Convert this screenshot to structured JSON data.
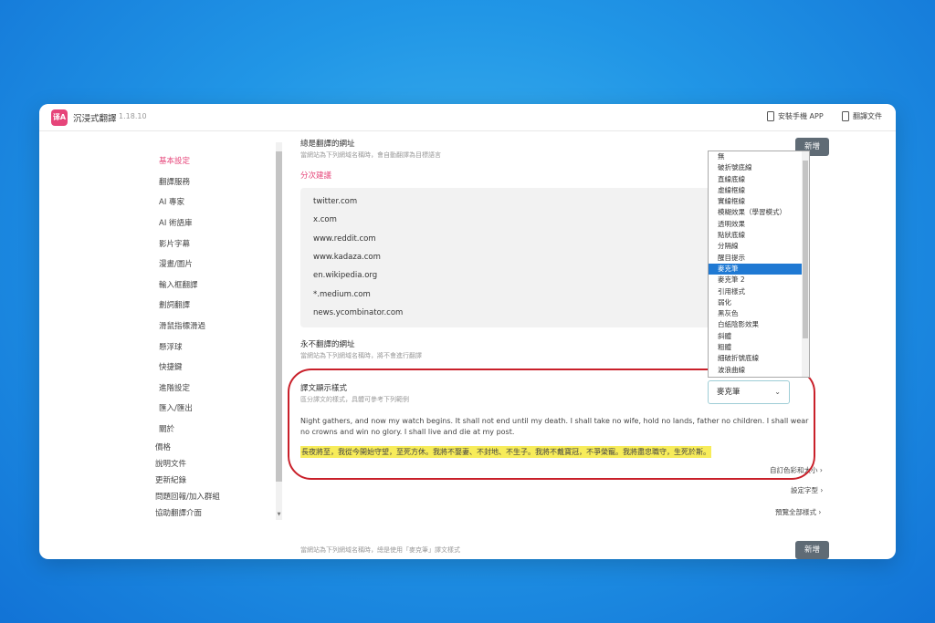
{
  "app": {
    "name": "沉浸式翻譯",
    "version": "1.18.10",
    "logo_text": "译A"
  },
  "topbar": {
    "install_app": "安裝手機 APP",
    "docs": "翻譯文件"
  },
  "sidebar": {
    "items": [
      {
        "label": "基本設定"
      },
      {
        "label": "翻譯服務"
      },
      {
        "label": "AI 專家"
      },
      {
        "label": "AI 術語庫"
      },
      {
        "label": "影片字幕"
      },
      {
        "label": "漫畫/圖片"
      },
      {
        "label": "輸入框翻譯"
      },
      {
        "label": "劃詞翻譯"
      },
      {
        "label": "滑鼠指標滑過"
      },
      {
        "label": "懸浮球"
      },
      {
        "label": "快捷鍵"
      },
      {
        "label": "進階設定"
      },
      {
        "label": "匯入/匯出"
      },
      {
        "label": "關於"
      }
    ],
    "links": [
      {
        "label": "價格"
      },
      {
        "label": "說明文件"
      },
      {
        "label": "更新紀錄"
      },
      {
        "label": "問題回報/加入群組"
      },
      {
        "label": "協助翻譯介面"
      }
    ]
  },
  "main": {
    "always_title": "總是翻譯的網址",
    "always_hint": "當網站為下列網域名稱時，會自動翻譯為目標語言",
    "add_label": "新增",
    "suggestion_title": "分次建議",
    "urls": [
      "twitter.com",
      "x.com",
      "www.reddit.com",
      "www.kadaza.com",
      "en.wikipedia.org",
      "*.medium.com",
      "news.ycombinator.com"
    ],
    "never_title": "永不翻譯的網址",
    "never_hint": "當網站為下列網域名稱時，將不會進行翻譯",
    "style_title": "譯文顯示樣式",
    "style_hint": "區分譯文的樣式，具體可參考下列範例",
    "selected_style": "麥克筆",
    "sample_en": "Night gathers, and now my watch begins. It shall not end until my death. I shall take no wife, hold no lands, father no children. I shall wear no crowns and win no glory. I shall live and die at my post.",
    "sample_zh": "長夜將至，我從今開始守望，至死方休。我將不娶妻、不封地、不生子。我將不戴寶冠，不爭榮寵。我將盡忠職守，生死於斯。",
    "custom_color": "自訂色彩和大小",
    "set_font": "設定字型",
    "preview_all": "預覽全部樣式",
    "footer_hint": "當網站為下列網域名稱時，總是使用「麥克筆」譯文樣式",
    "footer_add": "新增"
  },
  "dropdown": {
    "options": [
      "無",
      "破折號底線",
      "直線底線",
      "虛線框線",
      "實線框線",
      "模糊效果（學習模式）",
      "透明效果",
      "點狀底線",
      "分隔線",
      "醒目提示",
      "麥克筆",
      "麥克筆 2",
      "引用樣式",
      "弱化",
      "黑灰色",
      "白紙陰影效果",
      "斜體",
      "粗體",
      "細破折號底線",
      "波浪曲線"
    ],
    "selected_index": 10
  },
  "colors": {
    "accent": "#e6457a",
    "highlight": "#f7ec5a",
    "outline": "#c9202a",
    "selected": "#1f79d3"
  }
}
